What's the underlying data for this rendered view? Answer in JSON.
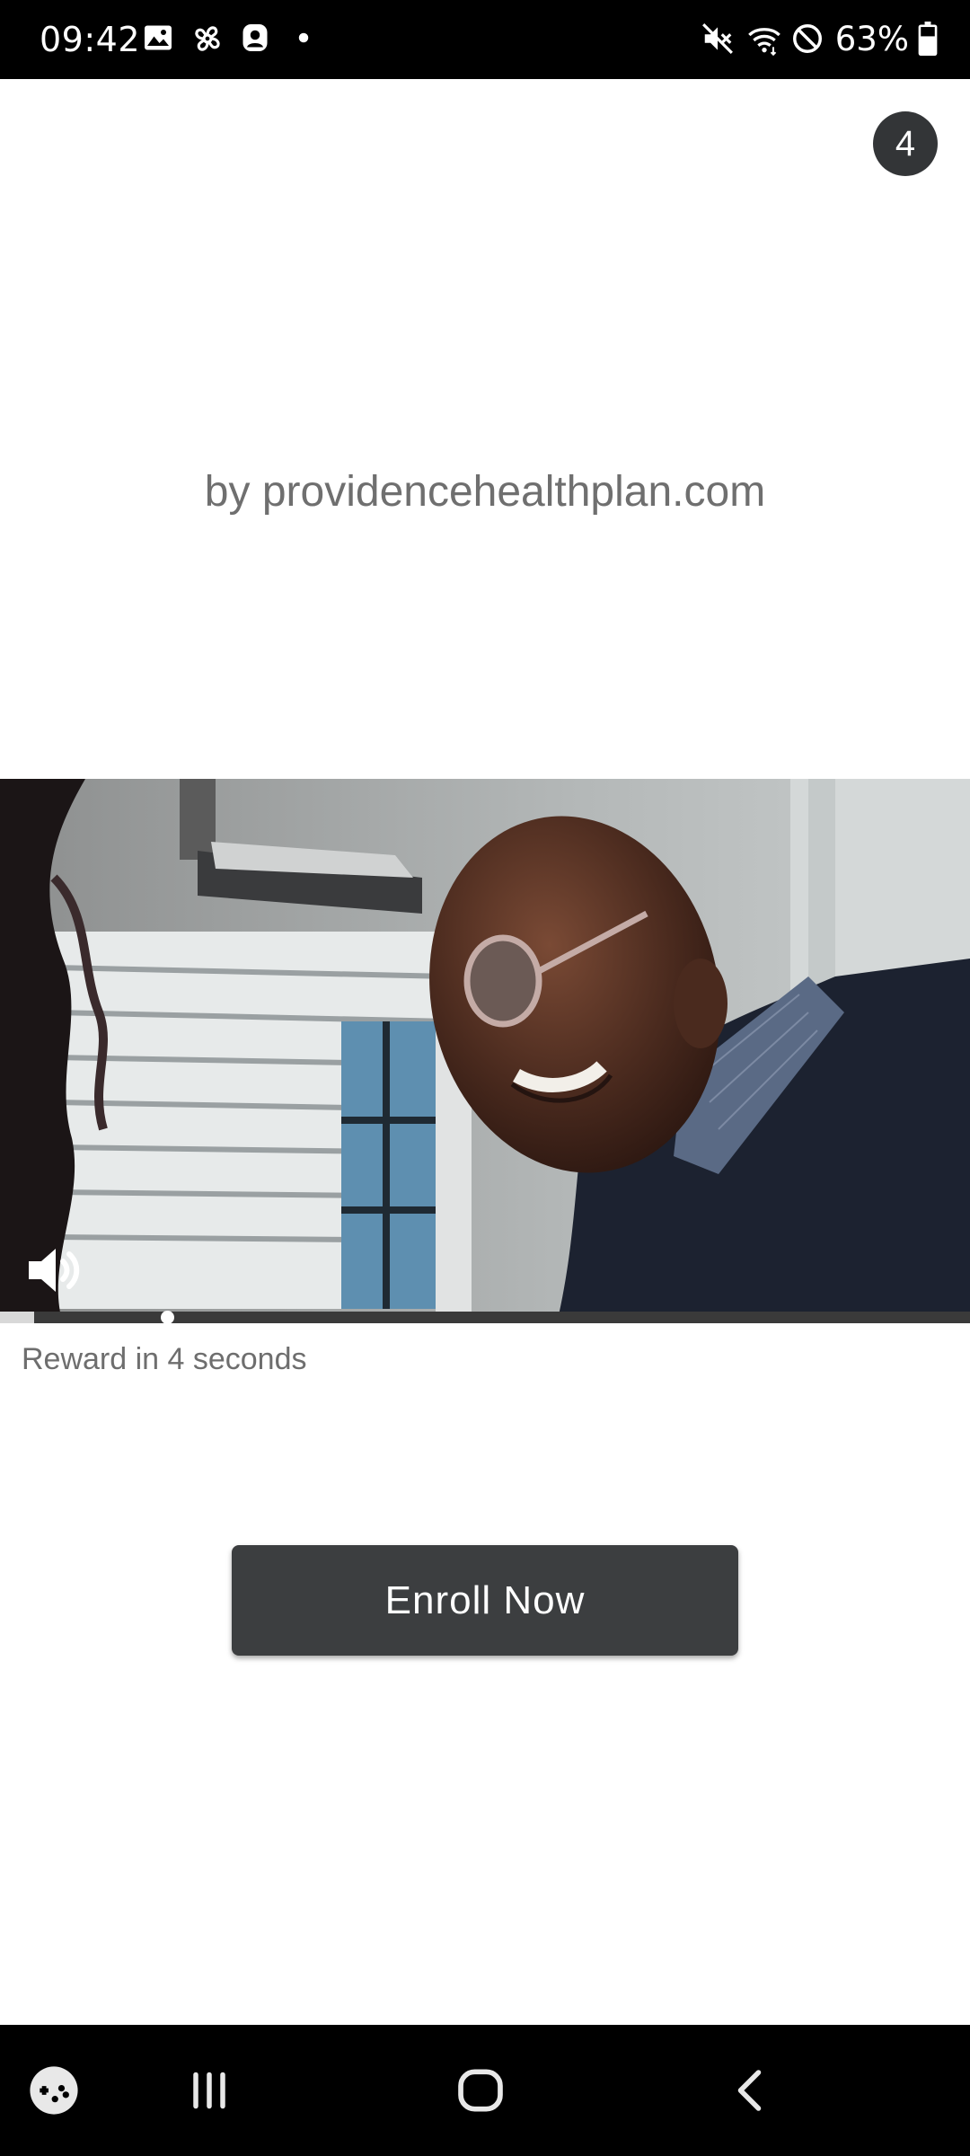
{
  "status_bar": {
    "time": "09:42",
    "battery_percent": "63%",
    "left_icons": [
      "gallery-icon",
      "fan-icon",
      "account-icon",
      "notification-dot-icon"
    ],
    "right_icons": [
      "mute-icon",
      "wifi-icon",
      "do-not-disturb-icon",
      "battery-icon"
    ]
  },
  "ad": {
    "count_badge": "4",
    "advertiser": "by providencehealthplan.com",
    "video": {
      "volume_icon": "volume-icon",
      "progress": 0.035
    },
    "reward_text": "Reward in 4 seconds",
    "cta_label": "Enroll Now"
  },
  "nav_bar": {
    "items": [
      "game-launcher-icon",
      "recent-apps-icon",
      "home-icon",
      "back-icon"
    ]
  }
}
